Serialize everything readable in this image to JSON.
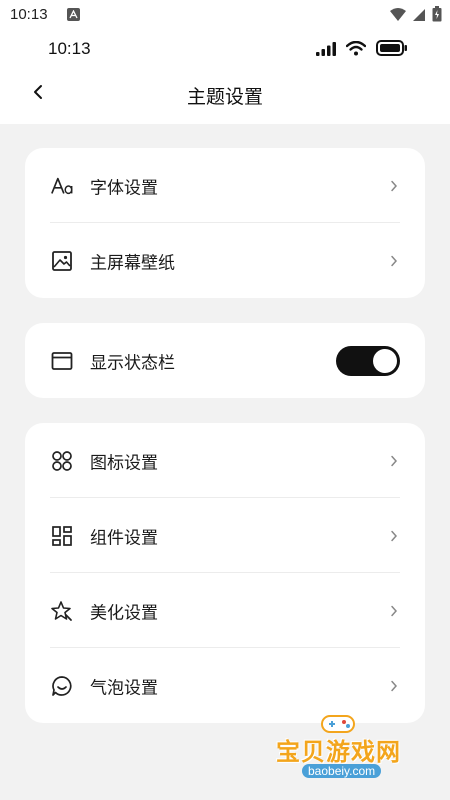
{
  "system_status": {
    "time": "10:13"
  },
  "app_status": {
    "time": "10:13"
  },
  "header": {
    "title": "主题设置"
  },
  "groups": [
    {
      "items": [
        {
          "label": "字体设置",
          "icon": "font-icon"
        },
        {
          "label": "主屏幕壁纸",
          "icon": "wallpaper-icon"
        }
      ]
    },
    {
      "items": [
        {
          "label": "显示状态栏",
          "icon": "window-icon",
          "toggle": true,
          "toggle_on": true
        }
      ]
    },
    {
      "items": [
        {
          "label": "图标设置",
          "icon": "app-icons-icon"
        },
        {
          "label": "组件设置",
          "icon": "widgets-icon"
        },
        {
          "label": "美化设置",
          "icon": "sparkle-star-icon"
        },
        {
          "label": "气泡设置",
          "icon": "chat-bubble-icon"
        }
      ]
    }
  ],
  "watermark": {
    "brand": "宝贝游戏网",
    "url": "baobeiy.com"
  },
  "colors": {
    "page_bg": "#f2f2f2",
    "card_bg": "#ffffff",
    "toggle_on": "#111111",
    "watermark_orange": "#f3a51c"
  }
}
